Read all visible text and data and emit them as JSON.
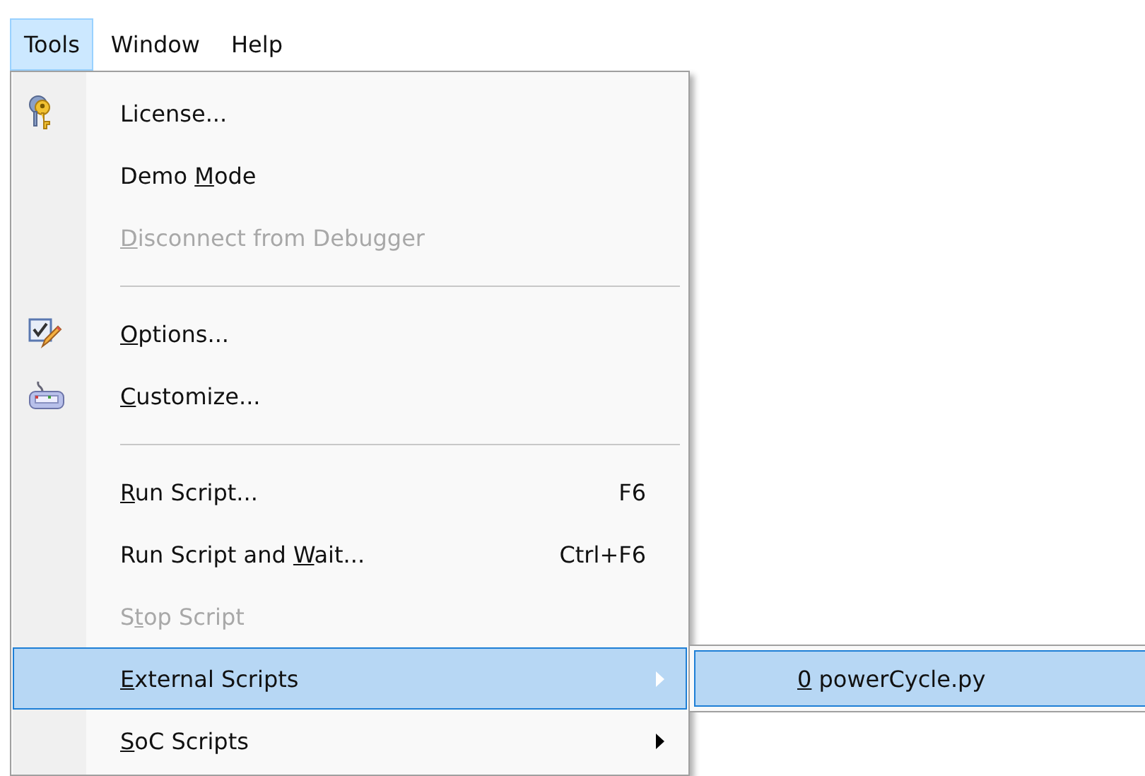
{
  "menubar": [
    {
      "label": "Tools",
      "selected": true
    },
    {
      "label": "Window",
      "selected": false
    },
    {
      "label": "Help",
      "selected": false
    }
  ],
  "menu": {
    "items": [
      {
        "kind": "item",
        "after": "License...",
        "disabled": false,
        "selected": false,
        "has_submenu": false
      },
      {
        "kind": "item",
        "before": "Demo ",
        "key": "M",
        "after": "ode",
        "disabled": false,
        "selected": false,
        "has_submenu": false
      },
      {
        "kind": "item",
        "key": "D",
        "after": "isconnect from Debugger",
        "disabled": true,
        "selected": false,
        "has_submenu": false
      },
      {
        "kind": "separator"
      },
      {
        "kind": "item",
        "key": "O",
        "after": "ptions...",
        "disabled": false,
        "selected": false,
        "has_submenu": false
      },
      {
        "kind": "item",
        "key": "C",
        "after": "ustomize...",
        "disabled": false,
        "selected": false,
        "has_submenu": false
      },
      {
        "kind": "separator"
      },
      {
        "kind": "item",
        "key": "R",
        "after": "un Script...",
        "shortcut": "F6",
        "disabled": false,
        "selected": false,
        "has_submenu": false
      },
      {
        "kind": "item",
        "before": "Run Script and ",
        "key": "W",
        "after": "ait...",
        "shortcut": "Ctrl+F6",
        "disabled": false,
        "selected": false,
        "has_submenu": false
      },
      {
        "kind": "item",
        "before": "S",
        "key": "t",
        "after": "op Script",
        "disabled": true,
        "selected": false,
        "has_submenu": false
      },
      {
        "kind": "item",
        "key": "E",
        "after": "xternal Scripts",
        "disabled": false,
        "selected": true,
        "has_submenu": true
      },
      {
        "kind": "item",
        "key": "S",
        "after": "oC Scripts",
        "disabled": false,
        "selected": false,
        "has_submenu": true
      }
    ]
  },
  "submenu": {
    "items": [
      {
        "key": "0",
        "after": " powerCycle.py",
        "selected": true
      }
    ]
  }
}
